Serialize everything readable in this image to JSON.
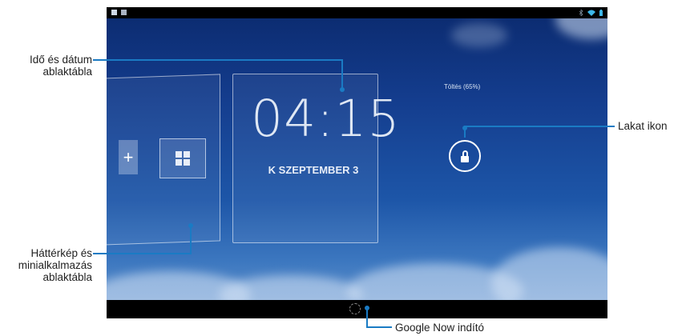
{
  "screen": {
    "charging_text": "Töltés (65%)",
    "clock_time": "04:15",
    "clock_date": "K SZEPTEMBER 3",
    "widget_add_symbol": "+"
  },
  "callouts": {
    "clock_panel": [
      "Idő és dátum",
      "ablaktábla"
    ],
    "wallpaper_panel": [
      "Háttérkép és",
      "minialkalmazás",
      "ablaktábla"
    ],
    "lock_icon": "Lakat ikon",
    "google_now": "Google Now indító"
  },
  "colors": {
    "callout_line": "#1a7bc4"
  },
  "icons": [
    "notification-icon",
    "image-icon",
    "bluetooth-icon",
    "wifi-icon",
    "battery-icon",
    "lock-icon",
    "google-now-icon"
  ]
}
